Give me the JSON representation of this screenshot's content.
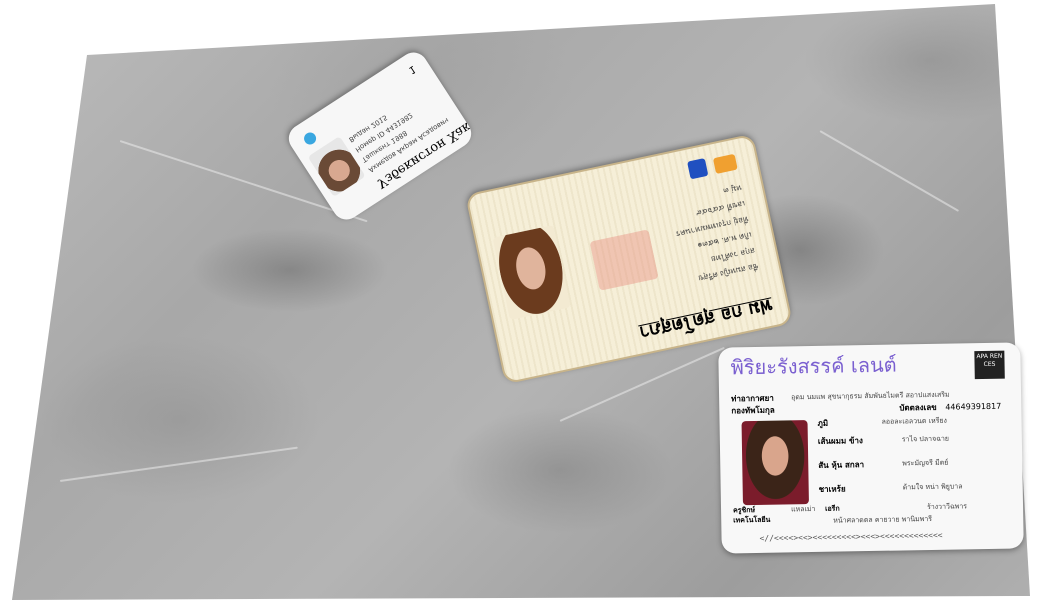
{
  "card_top_left": {
    "title": "Узбекистон Хакс",
    "lines": [
      "Ахмедов Акрам Асадович",
      "Ташкент 1988",
      "Номер ID 4431982",
      "Выдан 2015"
    ],
    "number": "1"
  },
  "card_center": {
    "title": "ฟม กอ สุดโตสุภา",
    "fields": [
      {
        "label": "ชื่อ",
        "value": "สมหญิง ศรีสุข"
      },
      {
        "label": "สกุล",
        "value": "วงศ์ไทย"
      },
      {
        "label": "เกิด",
        "value": "พ.ศ. ๒๕๓๑"
      },
      {
        "label": "ที่อยู่",
        "value": "กรุงเทพมหานคร"
      },
      {
        "label": "เลขที่",
        "value": "๔๔๖๔๙"
      },
      {
        "label": "หมู่",
        "value": "๓"
      }
    ]
  },
  "card_bottom_right": {
    "title": "พิริยะรังสรรค์ เลนต์",
    "logo": "APA REN CES",
    "labels": [
      "ท่าอากาศยา",
      "กองทัพโมกุล"
    ],
    "rows": [
      {
        "label": "ภูมิ",
        "value": "อุดม นมแพ สุขนากุธรม สัมพันธไมตรี สอาปแสงเสริม"
      },
      {
        "label": "บัตตลงเลข",
        "value": "44649391817"
      },
      {
        "label": "ภูมิ",
        "value": "ลออละเอลวนต เหรียง"
      },
      {
        "label": "เส้นผมม ข้าง",
        "value": "ราไจ ปลาจฉาย"
      },
      {
        "label": "สัน หุ้น สกลา",
        "value": "พระมัญจรี มีตย์"
      },
      {
        "label": "ชาเหร้ย",
        "value": "ด้ามใจ หน่า พิยูบาล"
      }
    ],
    "footer_left": [
      "ครูชิกษ์",
      "เทคโนโลยีน"
    ],
    "footer_mid": [
      "แหลเม่า",
      "เอรีก"
    ],
    "footer_right": [
      "หน้าศลาดตล คายวาย พานิมพารี",
      "ร้างวาวีฉพาร"
    ],
    "mrz": "<//<<<<><<><<<<<<<<<><<<><<<<<<<<<<<<<"
  }
}
